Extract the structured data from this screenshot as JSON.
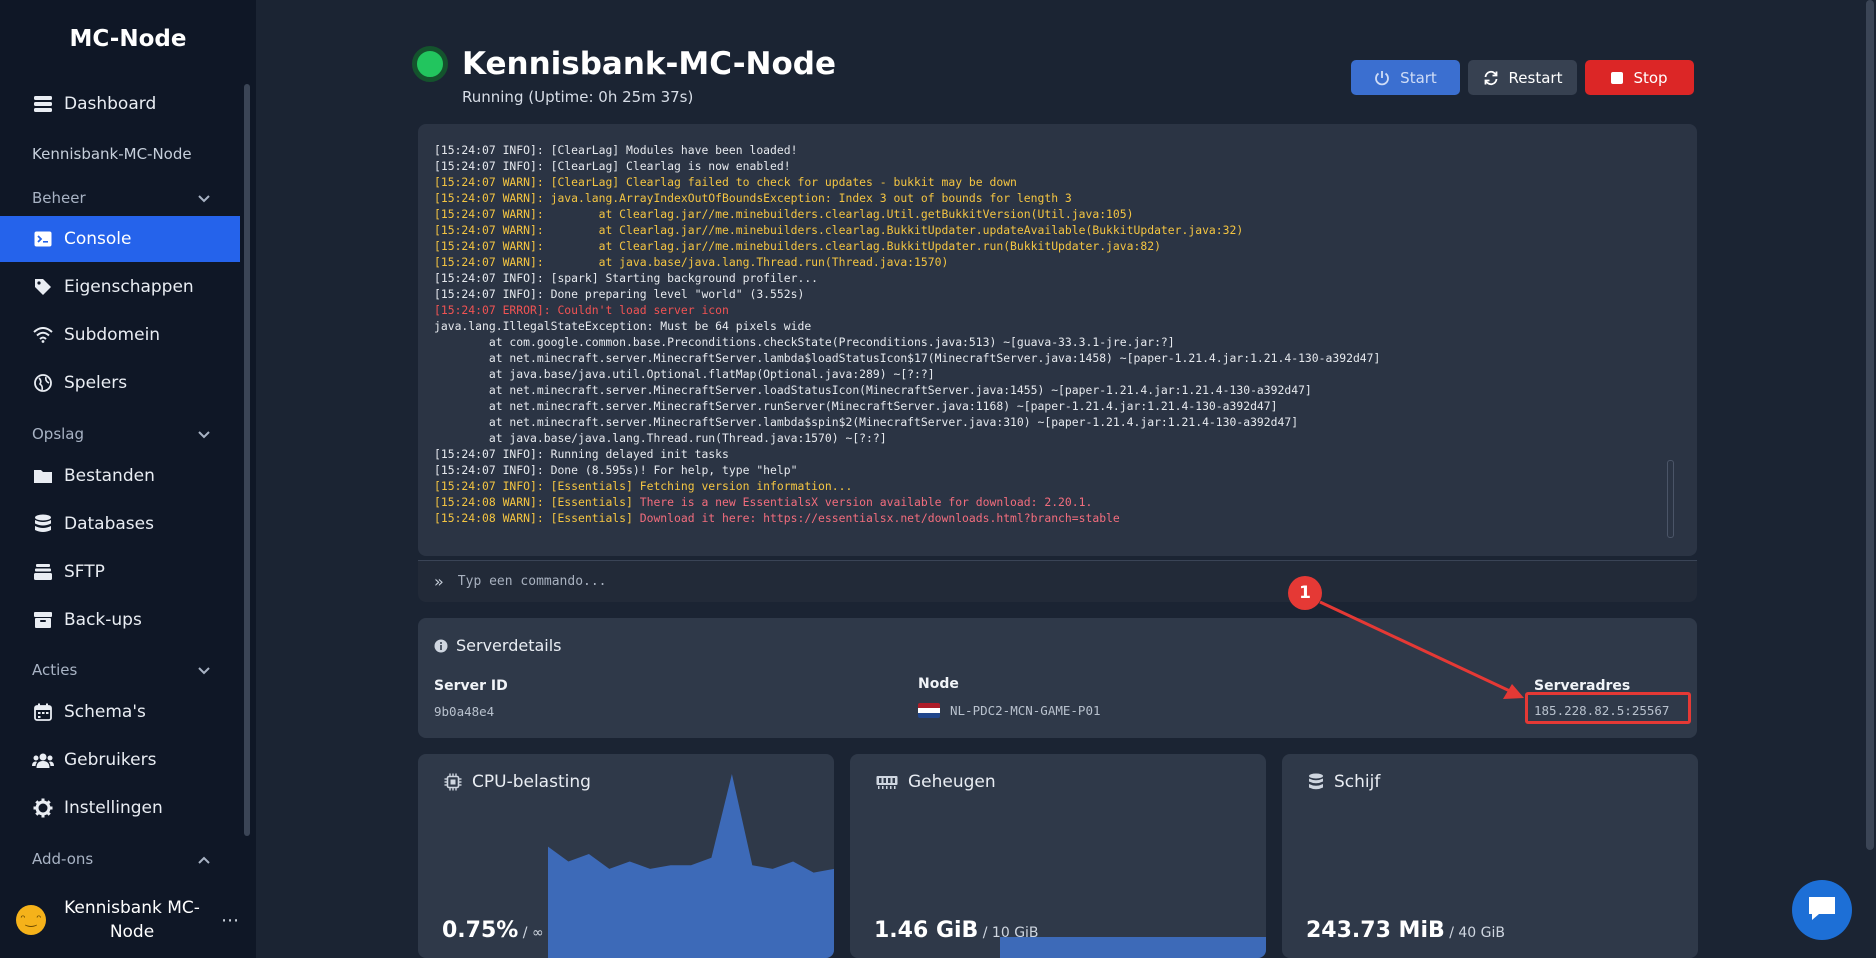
{
  "sidebar": {
    "brand": "MC-Node",
    "dashboard": "Dashboard",
    "server_name": "Kennisbank-MC-Node",
    "group_beheer": "Beheer",
    "console": "Console",
    "eigenschappen": "Eigenschappen",
    "subdomein": "Subdomein",
    "spelers": "Spelers",
    "group_opslag": "Opslag",
    "bestanden": "Bestanden",
    "databases": "Databases",
    "sftp": "SFTP",
    "backups": "Back-ups",
    "group_acties": "Acties",
    "schemas": "Schema's",
    "gebruikers": "Gebruikers",
    "instellingen": "Instellingen",
    "group_addons": "Add-ons",
    "user_name_line1": "Kennisbank MC-",
    "user_name_line2": "Node",
    "more": "⋯"
  },
  "header": {
    "title": "Kennisbank-MC-Node",
    "uptime": "Running (Uptime: 0h 25m 37s)",
    "start_label": "Start",
    "restart_label": "Restart",
    "stop_label": "Stop"
  },
  "console": {
    "lines": [
      {
        "t": "l",
        "text": "[15:24:07 INFO]: [ClearLag] Modules have been loaded!"
      },
      {
        "t": "l",
        "text": "[15:24:07 INFO]: [ClearLag] Clearlag is now enabled!"
      },
      {
        "t": "w",
        "text": "[15:24:07 WARN]: [ClearLag] Clearlag failed to check for updates - bukkit may be down"
      },
      {
        "t": "w",
        "text": "[15:24:07 WARN]: java.lang.ArrayIndexOutOfBoundsException: Index 3 out of bounds for length 3"
      },
      {
        "t": "w",
        "text": "[15:24:07 WARN]:        at Clearlag.jar//me.minebuilders.clearlag.Util.getBukkitVersion(Util.java:105)"
      },
      {
        "t": "w",
        "text": "[15:24:07 WARN]:        at Clearlag.jar//me.minebuilders.clearlag.BukkitUpdater.updateAvailable(BukkitUpdater.java:32)"
      },
      {
        "t": "w",
        "text": "[15:24:07 WARN]:        at Clearlag.jar//me.minebuilders.clearlag.BukkitUpdater.run(BukkitUpdater.java:82)"
      },
      {
        "t": "w",
        "text": "[15:24:07 WARN]:        at java.base/java.lang.Thread.run(Thread.java:1570)"
      },
      {
        "t": "l",
        "text": "[15:24:07 INFO]: [spark] Starting background profiler..."
      },
      {
        "t": "l",
        "text": "[15:24:07 INFO]: Done preparing level \"world\" (3.552s)"
      },
      {
        "t": "e",
        "text": "[15:24:07 ERROR]: Couldn't load server icon"
      },
      {
        "t": "l",
        "text": "java.lang.IllegalStateException: Must be 64 pixels wide"
      },
      {
        "t": "l",
        "text": "        at com.google.common.base.Preconditions.checkState(Preconditions.java:513) ~[guava-33.3.1-jre.jar:?]"
      },
      {
        "t": "l",
        "text": "        at net.minecraft.server.MinecraftServer.lambda$loadStatusIcon$17(MinecraftServer.java:1458) ~[paper-1.21.4.jar:1.21.4-130-a392d47]"
      },
      {
        "t": "l",
        "text": "        at java.base/java.util.Optional.flatMap(Optional.java:289) ~[?:?]"
      },
      {
        "t": "l",
        "text": "        at net.minecraft.server.MinecraftServer.loadStatusIcon(MinecraftServer.java:1455) ~[paper-1.21.4.jar:1.21.4-130-a392d47]"
      },
      {
        "t": "l",
        "text": "        at net.minecraft.server.MinecraftServer.runServer(MinecraftServer.java:1168) ~[paper-1.21.4.jar:1.21.4-130-a392d47]"
      },
      {
        "t": "l",
        "text": "        at net.minecraft.server.MinecraftServer.lambda$spin$2(MinecraftServer.java:310) ~[paper-1.21.4.jar:1.21.4-130-a392d47]"
      },
      {
        "t": "l",
        "text": "        at java.base/java.lang.Thread.run(Thread.java:1570) ~[?:?]"
      },
      {
        "t": "l",
        "text": "[15:24:07 INFO]: Running delayed init tasks"
      },
      {
        "t": "l",
        "text": "[15:24:07 INFO]: Done (8.595s)! For help, type \"help\""
      },
      {
        "t": "y",
        "prefix": "[15:24:07 INFO]: [Essentials] ",
        "text": "Fetching version information..."
      },
      {
        "t": "ess",
        "prefix": "[15:24:08 WARN]: [Essentials] ",
        "text": "There is a new EssentialsX version available for download: 2.20.1."
      },
      {
        "t": "ess",
        "prefix": "[15:24:08 WARN]: [Essentials] ",
        "text": "Download it here: https://essentialsx.net/downloads.html?branch=stable"
      }
    ],
    "command_placeholder": "Typ een commando..."
  },
  "details": {
    "title": "Serverdetails",
    "server_id_label": "Server ID",
    "server_id": "9b0a48e4",
    "node_label": "Node",
    "node": "NL-PDC2-MCN-GAME-P01",
    "address_label": "Serveradres",
    "address": "185.228.82.5:25567"
  },
  "annotation": {
    "number": "1"
  },
  "stats": {
    "cpu": {
      "title": "CPU-belasting",
      "value": "0.75%",
      "limit": " / ∞",
      "history_percent": [
        0,
        0,
        0,
        0,
        0,
        0,
        0,
        0,
        30,
        26,
        28,
        24,
        26,
        24,
        25,
        25,
        27,
        66,
        25,
        24,
        26,
        23,
        24
      ]
    },
    "memory": {
      "title": "Geheugen",
      "value": "1.46 GiB",
      "limit": " / 10 GiB"
    },
    "disk": {
      "title": "Schijf",
      "value": "243.73 MiB",
      "limit": " / 40 GiB"
    }
  },
  "colors": {
    "accent": "#2563eb",
    "running": "#22c55e",
    "stop": "#dc2626",
    "chart": "#3d6ab8"
  }
}
